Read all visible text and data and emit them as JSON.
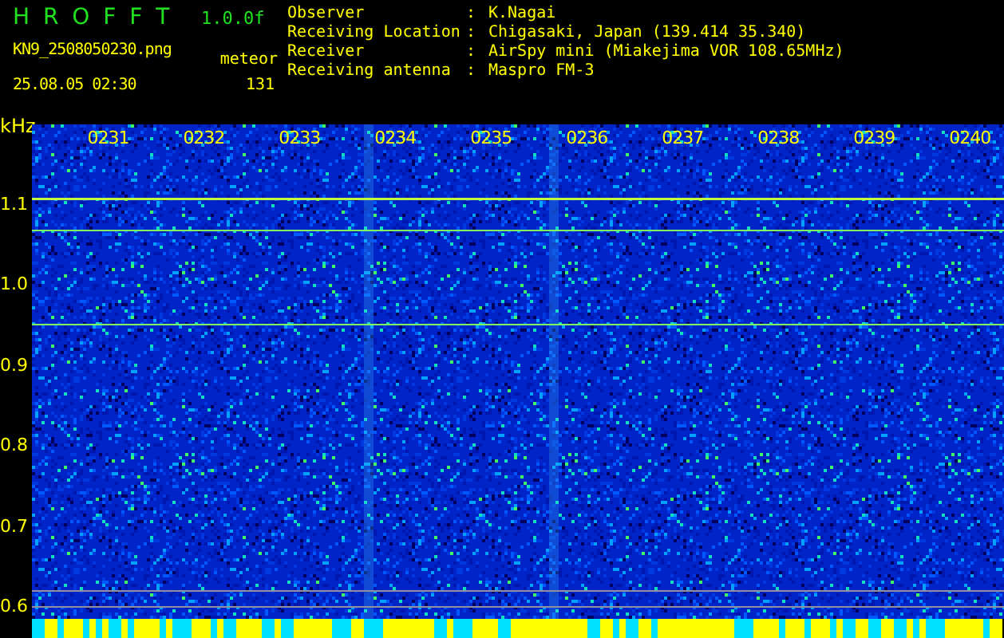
{
  "header": {
    "title": "H R O F F T",
    "version": "1.0.0f",
    "filename": "KN9_2508050230.png",
    "datetime": "25.08.05 02:30",
    "mode": "meteor",
    "count": "131"
  },
  "info": [
    {
      "label": "Observer",
      "separator": ":",
      "value": "K.Nagai"
    },
    {
      "label": "Receiving Location",
      "separator": ":",
      "value": "Chigasaki, Japan (139.414 35.340)"
    },
    {
      "label": "Receiver",
      "separator": ":",
      "value": "AirSpy mini (Miakejima VOR 108.65MHz)"
    },
    {
      "label": "Receiving antenna",
      "separator": ":",
      "value": "Maspro FM-3"
    }
  ],
  "plot": {
    "unit": "kHz",
    "y_labels": [
      "1.1",
      "1.0",
      "0.9",
      "0.8",
      "0.7",
      "0.6"
    ],
    "time_labels": [
      "0231",
      "0232",
      "0233",
      "0234",
      "0235",
      "0236",
      "0237",
      "0238",
      "0239",
      "0240"
    ]
  }
}
